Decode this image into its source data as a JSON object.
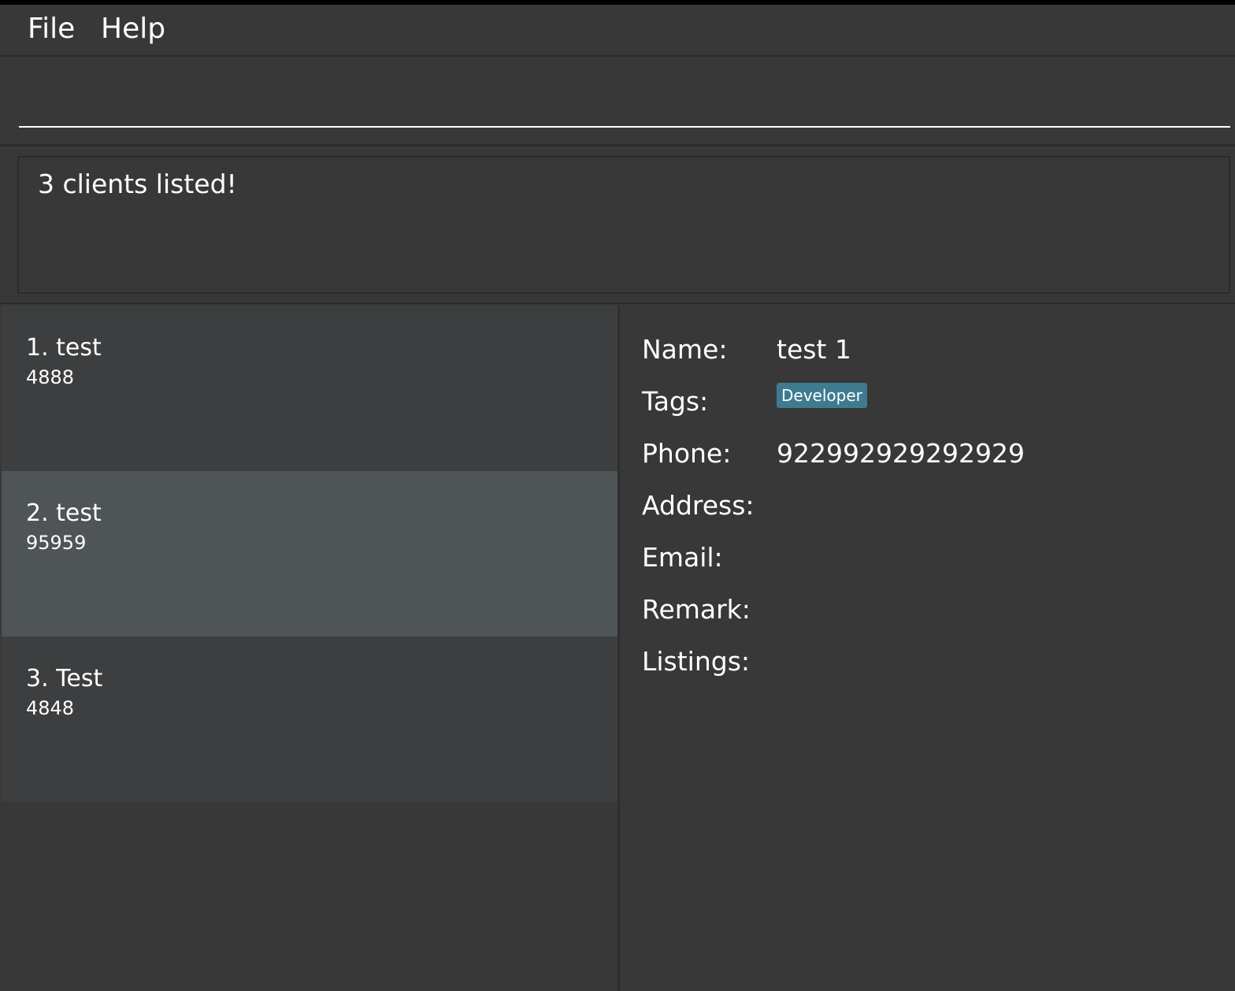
{
  "menu": {
    "file_label": "File",
    "help_label": "Help"
  },
  "command": {
    "value": "",
    "placeholder": ""
  },
  "result": {
    "message": "3 clients listed!"
  },
  "clients": [
    {
      "name": "1. test",
      "phone": "4888"
    },
    {
      "name": "2. test",
      "phone": "95959"
    },
    {
      "name": "3. Test",
      "phone": "4848"
    }
  ],
  "selected_index": 1,
  "details": {
    "name_label": "Name:",
    "name_value": "test 1",
    "tags_label": "Tags:",
    "tags": [
      "Developer"
    ],
    "phone_label": "Phone:",
    "phone_value": "922992929292929",
    "address_label": "Address:",
    "address_value": "",
    "email_label": "Email:",
    "email_value": "",
    "remark_label": "Remark:",
    "remark_value": "",
    "listings_label": "Listings:",
    "listings_value": ""
  },
  "colors": {
    "background": "#383838",
    "selected_row": "#4f5456",
    "row": "#3c3e3f",
    "tag": "#3e7b91"
  }
}
